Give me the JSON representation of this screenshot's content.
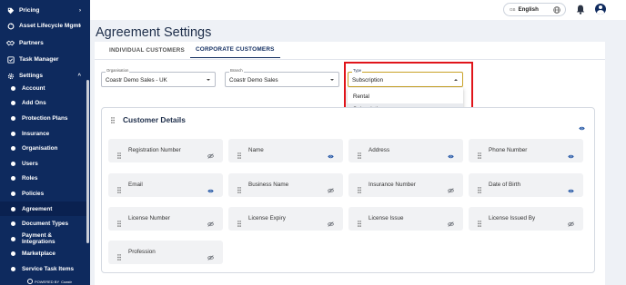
{
  "sidebar": {
    "items": [
      {
        "label": "Pricing",
        "icon": "tag-icon",
        "chevron": "›",
        "type": "top"
      },
      {
        "label": "Asset Lifecycle Mgmt",
        "icon": "lifecycle-icon",
        "chevron": "›",
        "type": "top"
      },
      {
        "label": "Partners",
        "icon": "handshake-icon",
        "chevron": "",
        "type": "top"
      },
      {
        "label": "Task Manager",
        "icon": "task-icon",
        "chevron": "",
        "type": "top"
      },
      {
        "label": "Settings",
        "icon": "gear-icon",
        "chevron": "^",
        "type": "top"
      },
      {
        "label": "Account",
        "type": "sub"
      },
      {
        "label": "Add Ons",
        "type": "sub"
      },
      {
        "label": "Protection Plans",
        "type": "sub"
      },
      {
        "label": "Insurance",
        "type": "sub"
      },
      {
        "label": "Organisation",
        "type": "sub"
      },
      {
        "label": "Users",
        "type": "sub"
      },
      {
        "label": "Roles",
        "type": "sub"
      },
      {
        "label": "Policies",
        "type": "sub"
      },
      {
        "label": "Agreement",
        "type": "sub",
        "active": true
      },
      {
        "label": "Document Types",
        "type": "sub"
      },
      {
        "label": "Payment & Integrations",
        "type": "sub"
      },
      {
        "label": "Marketplace",
        "type": "sub"
      },
      {
        "label": "Service Task Items",
        "type": "sub"
      }
    ],
    "powered_by": "POWERED BY",
    "powered_brand": "Coastr"
  },
  "topbar": {
    "language_code": "GB",
    "language": "English",
    "icons": [
      "globe-icon",
      "bell-icon",
      "user-avatar-icon"
    ]
  },
  "page": {
    "title": "Agreement Settings",
    "tabs": [
      "INDIVIDUAL CUSTOMERS",
      "CORPORATE CUSTOMERS"
    ],
    "active_tab": "CORPORATE CUSTOMERS"
  },
  "filters": {
    "organisation": {
      "label": "Organisation",
      "value": "Coastr Demo Sales - UK"
    },
    "branch": {
      "label": "Branch",
      "value": "Coastr Demo Sales"
    },
    "type": {
      "label": "Type",
      "value": "Subscription",
      "options": [
        "Rental",
        "Subscription"
      ]
    }
  },
  "customer_details": {
    "title": "Customer Details",
    "fields": [
      {
        "label": "Registration Number",
        "visible": false
      },
      {
        "label": "Name",
        "visible": true
      },
      {
        "label": "Address",
        "visible": true
      },
      {
        "label": "Phone Number",
        "visible": true
      },
      {
        "label": "Email",
        "visible": true
      },
      {
        "label": "Business Name",
        "visible": false
      },
      {
        "label": "Insurance Number",
        "visible": false
      },
      {
        "label": "Date of Birth",
        "visible": true
      },
      {
        "label": "License Number",
        "visible": false
      },
      {
        "label": "License Expiry",
        "visible": false
      },
      {
        "label": "License Issue",
        "visible": false
      },
      {
        "label": "License Issued By",
        "visible": false
      },
      {
        "label": "Profession",
        "visible": false
      }
    ]
  },
  "colors": {
    "sidebar_bg": "#0e2a5e",
    "eye_visible": "#1a4fa0",
    "eye_hidden": "#6b6f76",
    "highlight": "#e0141a"
  }
}
